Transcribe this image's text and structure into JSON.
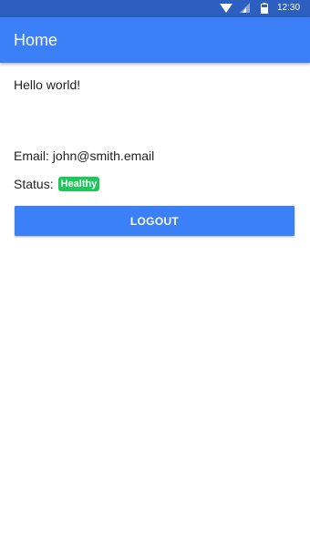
{
  "status_bar": {
    "time": "12:30",
    "icons": [
      "wifi-icon",
      "signal-icon",
      "battery-icon"
    ]
  },
  "app_bar": {
    "title": "Home"
  },
  "content": {
    "greeting": "Hello world!",
    "email_label": "Email:",
    "email_value": "john@smith.email",
    "status_label": "Status:",
    "status_badge": "Healthy",
    "logout_label": "LOGOUT"
  },
  "colors": {
    "status_bar": "#2c5fbf",
    "primary": "#3b80f7",
    "badge_green": "#1ec759",
    "text": "#222222"
  }
}
